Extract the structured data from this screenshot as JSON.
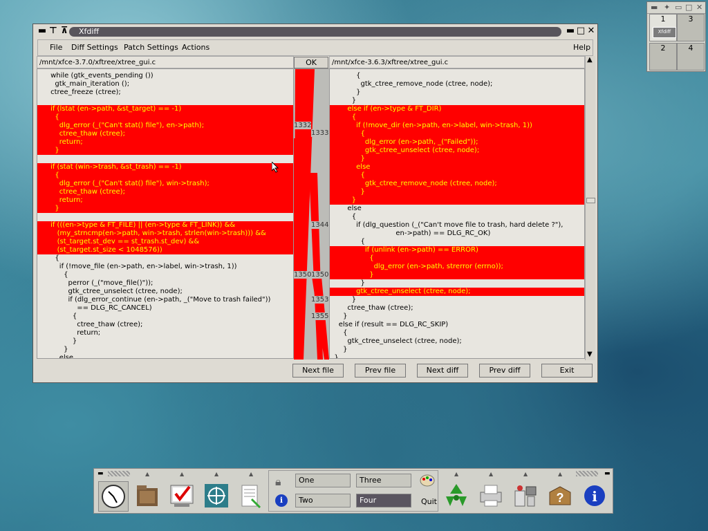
{
  "window": {
    "title": "Xfdiff",
    "menu": [
      "File",
      "Diff Settings",
      "Patch Settings",
      "Actions"
    ],
    "help": "Help",
    "left_path": "/mnt/xfce-3.7.0/xftree/xtree_gui.c",
    "right_path": "/mnt/xfce-3.6.3/xftree/xtree_gui.c",
    "ok_label": "OK",
    "buttons": [
      "Next file",
      "Prev file",
      "Next diff",
      "Prev diff",
      "Exit"
    ]
  },
  "left_lines": [
    {
      "t": "      while (gtk_events_pending ())",
      "h": false
    },
    {
      "t": "        gtk_main_iteration ();",
      "h": false
    },
    {
      "t": "      ctree_freeze (ctree);",
      "h": false
    },
    {
      "t": "",
      "h": false
    },
    {
      "t": "      if (lstat (en->path, &st_target) == -1)",
      "h": true
    },
    {
      "t": "        {",
      "h": true
    },
    {
      "t": "          dlg_error (_(\"Can't stat() file\"), en->path);",
      "h": true
    },
    {
      "t": "          ctree_thaw (ctree);",
      "h": true
    },
    {
      "t": "          return;",
      "h": true
    },
    {
      "t": "        }",
      "h": true
    },
    {
      "t": "",
      "h": false
    },
    {
      "t": "      if (stat (win->trash, &st_trash) == -1)",
      "h": true
    },
    {
      "t": "        {",
      "h": true
    },
    {
      "t": "          dlg_error (_(\"Can't stat() file\"), win->trash);",
      "h": true
    },
    {
      "t": "          ctree_thaw (ctree);",
      "h": true
    },
    {
      "t": "          return;",
      "h": true
    },
    {
      "t": "        }",
      "h": true
    },
    {
      "t": "",
      "h": false
    },
    {
      "t": "      if (((en->type & FT_FILE) || (en->type & FT_LINK)) &&",
      "h": true
    },
    {
      "t": "         (my_strncmp(en->path, win->trash, strlen(win->trash))) &&",
      "h": true
    },
    {
      "t": "         (st_target.st_dev == st_trash.st_dev) &&",
      "h": true
    },
    {
      "t": "         (st_target.st_size < 1048576))",
      "h": true
    },
    {
      "t": "        {",
      "h": false
    },
    {
      "t": "          if (!move_file (en->path, en->label, win->trash, 1))",
      "h": false
    },
    {
      "t": "            {",
      "h": false
    },
    {
      "t": "              perror (_(\"move_file()\"));",
      "h": false
    },
    {
      "t": "              gtk_ctree_unselect (ctree, node);",
      "h": false
    },
    {
      "t": "              if (dlg_error_continue (en->path, _(\"Move to trash failed\"))",
      "h": false
    },
    {
      "t": "                  == DLG_RC_CANCEL)",
      "h": false
    },
    {
      "t": "                {",
      "h": false
    },
    {
      "t": "                  ctree_thaw (ctree);",
      "h": false
    },
    {
      "t": "                  return;",
      "h": false
    },
    {
      "t": "                }",
      "h": false
    },
    {
      "t": "            }",
      "h": false
    },
    {
      "t": "          else",
      "h": false
    }
  ],
  "right_lines": [
    {
      "t": "            {",
      "h": false
    },
    {
      "t": "              gtk_ctree_remove_node (ctree, node);",
      "h": false
    },
    {
      "t": "            }",
      "h": false
    },
    {
      "t": "          }",
      "h": false
    },
    {
      "t": "        else if (en->type & FT_DIR)",
      "h": true
    },
    {
      "t": "          {",
      "h": true
    },
    {
      "t": "            if (!move_dir (en->path, en->label, win->trash, 1))",
      "h": true
    },
    {
      "t": "              {",
      "h": true
    },
    {
      "t": "                dlg_error (en->path, _(\"Failed\"));",
      "h": true
    },
    {
      "t": "                gtk_ctree_unselect (ctree, node);",
      "h": true
    },
    {
      "t": "              }",
      "h": true
    },
    {
      "t": "            else",
      "h": true
    },
    {
      "t": "              {",
      "h": true
    },
    {
      "t": "                gtk_ctree_remove_node (ctree, node);",
      "h": true
    },
    {
      "t": "              }",
      "h": true
    },
    {
      "t": "          }",
      "h": true
    },
    {
      "t": "        else",
      "h": false
    },
    {
      "t": "          {",
      "h": false
    },
    {
      "t": "            if (dlg_question (_(\"Can't move file to trash, hard delete ?\"),",
      "h": false
    },
    {
      "t": "                              en->path) == DLG_RC_OK)",
      "h": false
    },
    {
      "t": "              {",
      "h": false
    },
    {
      "t": "                if (unlink (en->path) == ERROR)",
      "h": true
    },
    {
      "t": "                  {",
      "h": true
    },
    {
      "t": "                    dlg_error (en->path, strerror (errno));",
      "h": true
    },
    {
      "t": "                  }",
      "h": true
    },
    {
      "t": "              }",
      "h": false
    },
    {
      "t": "            gtk_ctree_unselect (ctree, node);",
      "h": true
    },
    {
      "t": "          }",
      "h": false
    },
    {
      "t": "        ctree_thaw (ctree);",
      "h": false
    },
    {
      "t": "      }",
      "h": false
    },
    {
      "t": "    else if (result == DLG_RC_SKIP)",
      "h": false
    },
    {
      "t": "      {",
      "h": false
    },
    {
      "t": "        gtk_ctree_unselect (ctree, node);",
      "h": false
    },
    {
      "t": "      }",
      "h": false
    },
    {
      "t": "  }",
      "h": false
    }
  ],
  "line_numbers": {
    "left": [
      "1332",
      "1350"
    ],
    "right": [
      "1333",
      "1344",
      "1350",
      "1353",
      "1355"
    ]
  },
  "pager": {
    "workspaces": [
      "1",
      "3",
      "2",
      "4"
    ],
    "mini_window_label": "Xfdiff"
  },
  "panel": {
    "workspaces": [
      "One",
      "Three",
      "Two",
      "Four"
    ],
    "quit_label": "Quit",
    "launchers": [
      "clock-icon",
      "file-manager-icon",
      "editor-icon",
      "terminal-icon",
      "notepad-icon",
      "recycle-icon",
      "printer-icon",
      "settings-icon",
      "help-icon",
      "info-icon"
    ]
  }
}
